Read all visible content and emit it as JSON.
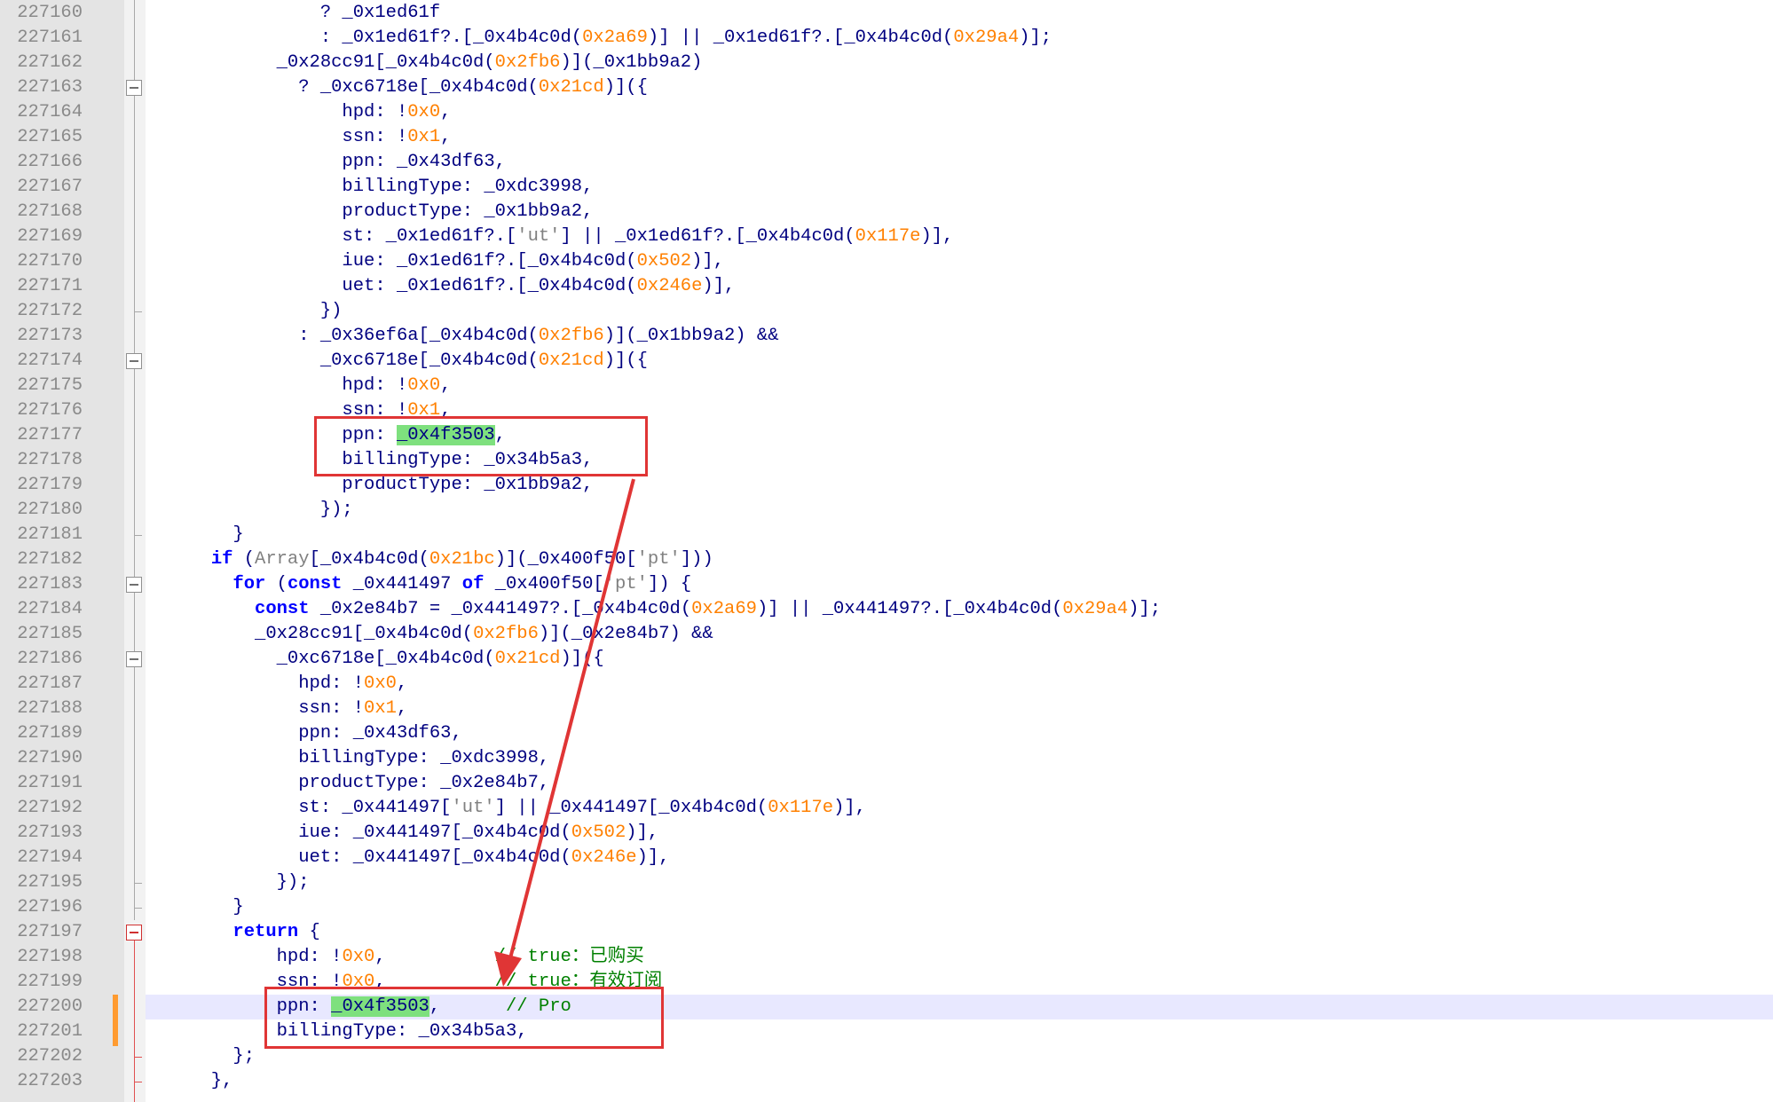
{
  "colors": {
    "plain": "#000080",
    "number": "#ff8000",
    "keyword": "#0000ff",
    "comment": "#008000",
    "string": "#808080",
    "highlight": "#7ee07e",
    "annotation": "#e03535"
  },
  "lines": [
    {
      "no": "227160",
      "parts": [
        {
          "t": "                ? _0x1ed61f",
          "c": "p"
        }
      ]
    },
    {
      "no": "227161",
      "parts": [
        {
          "t": "                : _0x1ed61f?.[_0x4b4c0d(",
          "c": "p"
        },
        {
          "t": "0x2a69",
          "c": "n"
        },
        {
          "t": ")] || _0x1ed61f?.[_0x4b4c0d(",
          "c": "p"
        },
        {
          "t": "0x29a4",
          "c": "n"
        },
        {
          "t": ")];",
          "c": "p"
        }
      ]
    },
    {
      "no": "227162",
      "parts": [
        {
          "t": "            _0x28cc91[_0x4b4c0d(",
          "c": "p"
        },
        {
          "t": "0x2fb6",
          "c": "n"
        },
        {
          "t": ")](_0x1bb9a2)",
          "c": "p"
        }
      ]
    },
    {
      "no": "227163",
      "parts": [
        {
          "t": "              ? _0xc6718e[_0x4b4c0d(",
          "c": "p"
        },
        {
          "t": "0x21cd",
          "c": "n"
        },
        {
          "t": ")]({",
          "c": "p"
        }
      ]
    },
    {
      "no": "227164",
      "parts": [
        {
          "t": "                  hpd: !",
          "c": "p"
        },
        {
          "t": "0x0",
          "c": "n"
        },
        {
          "t": ",",
          "c": "p"
        }
      ]
    },
    {
      "no": "227165",
      "parts": [
        {
          "t": "                  ssn: !",
          "c": "p"
        },
        {
          "t": "0x1",
          "c": "n"
        },
        {
          "t": ",",
          "c": "p"
        }
      ]
    },
    {
      "no": "227166",
      "parts": [
        {
          "t": "                  ppn: _0x43df63,",
          "c": "p"
        }
      ]
    },
    {
      "no": "227167",
      "parts": [
        {
          "t": "                  billingType: _0xdc3998,",
          "c": "p"
        }
      ]
    },
    {
      "no": "227168",
      "parts": [
        {
          "t": "                  productType: _0x1bb9a2,",
          "c": "p"
        }
      ]
    },
    {
      "no": "227169",
      "parts": [
        {
          "t": "                  st: _0x1ed61f?.[",
          "c": "p"
        },
        {
          "t": "'ut'",
          "c": "s"
        },
        {
          "t": "] || _0x1ed61f?.[_0x4b4c0d(",
          "c": "p"
        },
        {
          "t": "0x117e",
          "c": "n"
        },
        {
          "t": ")],",
          "c": "p"
        }
      ]
    },
    {
      "no": "227170",
      "parts": [
        {
          "t": "                  iue: _0x1ed61f?.[_0x4b4c0d(",
          "c": "p"
        },
        {
          "t": "0x502",
          "c": "n"
        },
        {
          "t": ")],",
          "c": "p"
        }
      ]
    },
    {
      "no": "227171",
      "parts": [
        {
          "t": "                  uet: _0x1ed61f?.[_0x4b4c0d(",
          "c": "p"
        },
        {
          "t": "0x246e",
          "c": "n"
        },
        {
          "t": ")],",
          "c": "p"
        }
      ]
    },
    {
      "no": "227172",
      "parts": [
        {
          "t": "                })",
          "c": "p"
        }
      ]
    },
    {
      "no": "227173",
      "parts": [
        {
          "t": "              : _0x36ef6a[_0x4b4c0d(",
          "c": "p"
        },
        {
          "t": "0x2fb6",
          "c": "n"
        },
        {
          "t": ")](_0x1bb9a2) &&",
          "c": "p"
        }
      ]
    },
    {
      "no": "227174",
      "parts": [
        {
          "t": "                _0xc6718e[_0x4b4c0d(",
          "c": "p"
        },
        {
          "t": "0x21cd",
          "c": "n"
        },
        {
          "t": ")]({",
          "c": "p"
        }
      ]
    },
    {
      "no": "227175",
      "parts": [
        {
          "t": "                  hpd: !",
          "c": "p"
        },
        {
          "t": "0x0",
          "c": "n"
        },
        {
          "t": ",",
          "c": "p"
        }
      ]
    },
    {
      "no": "227176",
      "parts": [
        {
          "t": "                  ssn: !",
          "c": "p"
        },
        {
          "t": "0x1",
          "c": "n"
        },
        {
          "t": ",",
          "c": "p"
        }
      ]
    },
    {
      "no": "227177",
      "parts": [
        {
          "t": "                  ppn: ",
          "c": "p"
        },
        {
          "t": "_0x4f3503",
          "c": "h"
        },
        {
          "t": ",",
          "c": "p"
        }
      ]
    },
    {
      "no": "227178",
      "parts": [
        {
          "t": "                  billingType: _0x34b5a3,",
          "c": "p"
        }
      ]
    },
    {
      "no": "227179",
      "parts": [
        {
          "t": "                  productType: _0x1bb9a2,",
          "c": "p"
        }
      ]
    },
    {
      "no": "227180",
      "parts": [
        {
          "t": "                });",
          "c": "p"
        }
      ]
    },
    {
      "no": "227181",
      "parts": [
        {
          "t": "        }",
          "c": "p"
        }
      ]
    },
    {
      "no": "227182",
      "parts": [
        {
          "t": "      ",
          "c": "p"
        },
        {
          "t": "if",
          "c": "k"
        },
        {
          "t": " (",
          "c": "p"
        },
        {
          "t": "Array",
          "c": "s"
        },
        {
          "t": "[_0x4b4c0d(",
          "c": "p"
        },
        {
          "t": "0x21bc",
          "c": "n"
        },
        {
          "t": ")](_0x400f50[",
          "c": "p"
        },
        {
          "t": "'pt'",
          "c": "s"
        },
        {
          "t": "]))",
          "c": "p"
        }
      ]
    },
    {
      "no": "227183",
      "parts": [
        {
          "t": "        ",
          "c": "p"
        },
        {
          "t": "for",
          "c": "k"
        },
        {
          "t": " (",
          "c": "p"
        },
        {
          "t": "const",
          "c": "k"
        },
        {
          "t": " _0x441497 ",
          "c": "p"
        },
        {
          "t": "of",
          "c": "k"
        },
        {
          "t": " _0x400f50[",
          "c": "p"
        },
        {
          "t": "'pt'",
          "c": "s"
        },
        {
          "t": "]) {",
          "c": "p"
        }
      ]
    },
    {
      "no": "227184",
      "parts": [
        {
          "t": "          ",
          "c": "p"
        },
        {
          "t": "const",
          "c": "k"
        },
        {
          "t": " _0x2e84b7 = _0x441497?.[_0x4b4c0d(",
          "c": "p"
        },
        {
          "t": "0x2a69",
          "c": "n"
        },
        {
          "t": ")] || _0x441497?.[_0x4b4c0d(",
          "c": "p"
        },
        {
          "t": "0x29a4",
          "c": "n"
        },
        {
          "t": ")];",
          "c": "p"
        }
      ]
    },
    {
      "no": "227185",
      "parts": [
        {
          "t": "          _0x28cc91[_0x4b4c0d(",
          "c": "p"
        },
        {
          "t": "0x2fb6",
          "c": "n"
        },
        {
          "t": ")](_0x2e84b7) &&",
          "c": "p"
        }
      ]
    },
    {
      "no": "227186",
      "parts": [
        {
          "t": "            _0xc6718e[_0x4b4c0d(",
          "c": "p"
        },
        {
          "t": "0x21cd",
          "c": "n"
        },
        {
          "t": ")]({",
          "c": "p"
        }
      ]
    },
    {
      "no": "227187",
      "parts": [
        {
          "t": "              hpd: !",
          "c": "p"
        },
        {
          "t": "0x0",
          "c": "n"
        },
        {
          "t": ",",
          "c": "p"
        }
      ]
    },
    {
      "no": "227188",
      "parts": [
        {
          "t": "              ssn: !",
          "c": "p"
        },
        {
          "t": "0x1",
          "c": "n"
        },
        {
          "t": ",",
          "c": "p"
        }
      ]
    },
    {
      "no": "227189",
      "parts": [
        {
          "t": "              ppn: _0x43df63,",
          "c": "p"
        }
      ]
    },
    {
      "no": "227190",
      "parts": [
        {
          "t": "              billingType: _0xdc3998,",
          "c": "p"
        }
      ]
    },
    {
      "no": "227191",
      "parts": [
        {
          "t": "              productType: _0x2e84b7,",
          "c": "p"
        }
      ]
    },
    {
      "no": "227192",
      "parts": [
        {
          "t": "              st: _0x441497[",
          "c": "p"
        },
        {
          "t": "'ut'",
          "c": "s"
        },
        {
          "t": "] || _0x441497[_0x4b4c0d(",
          "c": "p"
        },
        {
          "t": "0x117e",
          "c": "n"
        },
        {
          "t": ")],",
          "c": "p"
        }
      ]
    },
    {
      "no": "227193",
      "parts": [
        {
          "t": "              iue: _0x441497[_0x4b4c0d(",
          "c": "p"
        },
        {
          "t": "0x502",
          "c": "n"
        },
        {
          "t": ")],",
          "c": "p"
        }
      ]
    },
    {
      "no": "227194",
      "parts": [
        {
          "t": "              uet: _0x441497[_0x4b4c0d(",
          "c": "p"
        },
        {
          "t": "0x246e",
          "c": "n"
        },
        {
          "t": ")],",
          "c": "p"
        }
      ]
    },
    {
      "no": "227195",
      "parts": [
        {
          "t": "            });",
          "c": "p"
        }
      ]
    },
    {
      "no": "227196",
      "parts": [
        {
          "t": "        }",
          "c": "p"
        }
      ]
    },
    {
      "no": "227197",
      "parts": [
        {
          "t": "        ",
          "c": "p"
        },
        {
          "t": "return",
          "c": "k"
        },
        {
          "t": " {",
          "c": "p"
        }
      ]
    },
    {
      "no": "227198",
      "parts": [
        {
          "t": "            hpd: !",
          "c": "p"
        },
        {
          "t": "0x0",
          "c": "n"
        },
        {
          "t": ",          ",
          "c": "p"
        },
        {
          "t": "// true：已购买",
          "c": "c"
        }
      ]
    },
    {
      "no": "227199",
      "parts": [
        {
          "t": "            ssn: !",
          "c": "p"
        },
        {
          "t": "0x0",
          "c": "n"
        },
        {
          "t": ",          ",
          "c": "p"
        },
        {
          "t": "// true：有效订阅",
          "c": "c"
        }
      ]
    },
    {
      "no": "227200",
      "current": true,
      "parts": [
        {
          "t": "            ppn: ",
          "c": "p"
        },
        {
          "t": "_0x4f3503",
          "c": "h"
        },
        {
          "t": ",      ",
          "c": "p"
        },
        {
          "t": "// Pro",
          "c": "c"
        }
      ]
    },
    {
      "no": "227201",
      "parts": [
        {
          "t": "            billingType: _0x34b5a3,",
          "c": "p"
        }
      ]
    },
    {
      "no": "227202",
      "parts": [
        {
          "t": "        };",
          "c": "p"
        }
      ]
    },
    {
      "no": "227203",
      "parts": [
        {
          "t": "      },",
          "c": "p"
        }
      ]
    }
  ]
}
